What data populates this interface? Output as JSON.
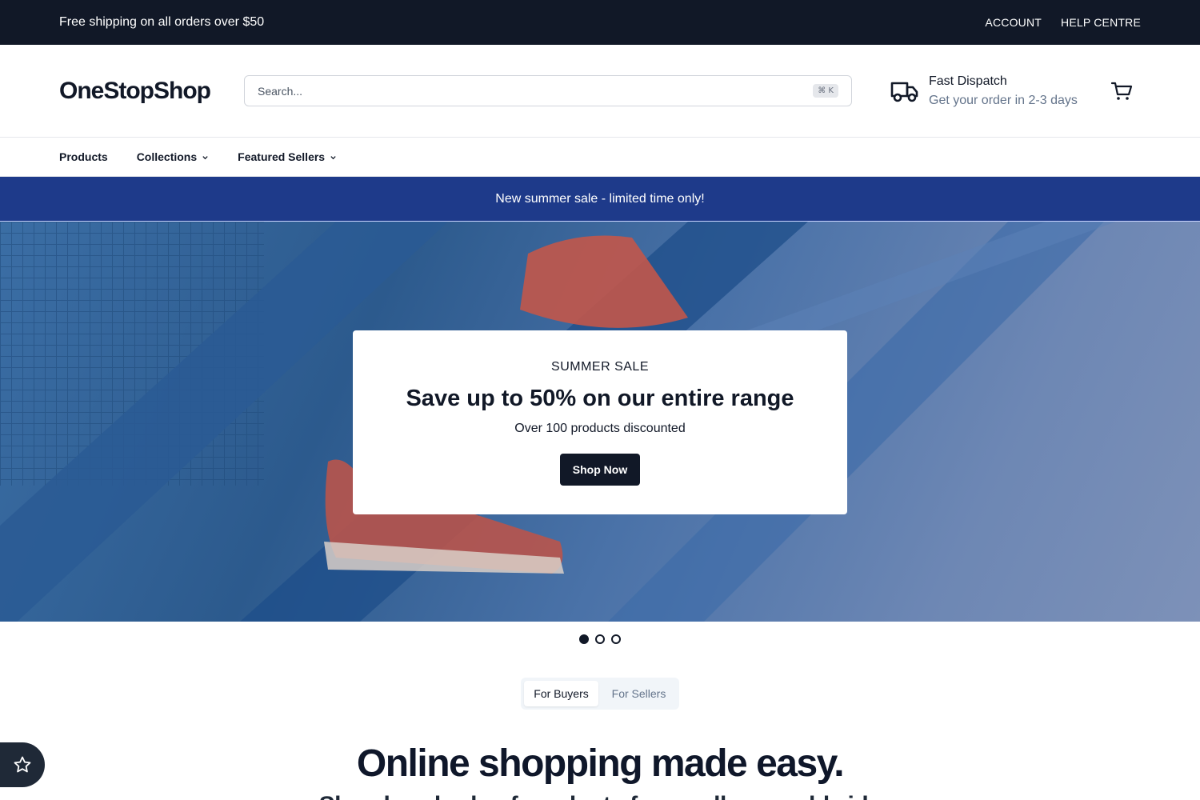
{
  "topbar": {
    "promo": "Free shipping on all orders over $50",
    "links": [
      "ACCOUNT",
      "HELP CENTRE"
    ]
  },
  "header": {
    "logo": "OneStopShop",
    "search_placeholder": "Search...",
    "search_shortcut": "⌘ K",
    "dispatch_title": "Fast Dispatch",
    "dispatch_subtitle": "Get your order in 2-3 days",
    "truck_icon": "truck-icon",
    "cart_icon": "cart-icon"
  },
  "nav": {
    "items": [
      "Products",
      "Collections",
      "Featured Sellers"
    ]
  },
  "sale_banner": {
    "text": "New summer sale - limited time only!",
    "color": "#1e3a8a"
  },
  "hero": {
    "eyebrow": "SUMMER SALE",
    "headline": "Save up to 50% on our entire range",
    "description": "Over 100 products discounted",
    "cta": "Shop Now",
    "slides_total": 3,
    "slide_active": 1
  },
  "audience_toggle": {
    "options": [
      "For Buyers",
      "For Sellers"
    ],
    "active": "For Buyers"
  },
  "intro": {
    "title": "Online shopping made easy.",
    "subtitle": "Shop hundreds of products from sellers worldwide"
  },
  "floating": {
    "icon": "star-icon"
  },
  "colors": {
    "dark": "#111827",
    "accent": "#1e3a8a"
  }
}
